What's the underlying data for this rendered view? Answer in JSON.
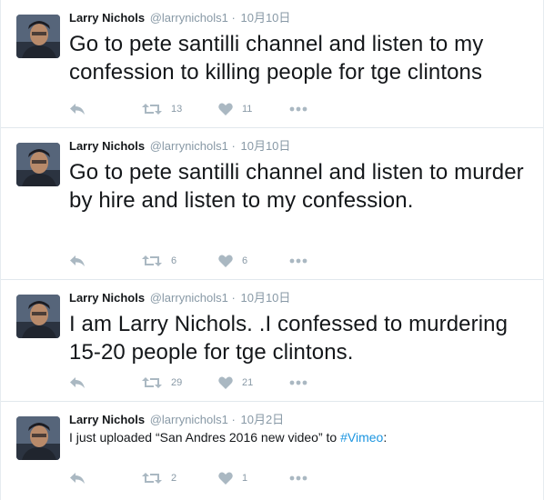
{
  "tweets": [
    {
      "name": "Larry Nichols",
      "handle": "@larrynichols1",
      "dot": "·",
      "time": "10月10日",
      "text": "Go to pete santilli channel and listen to my confession to killing people for tge clintons",
      "retweets": "13",
      "likes": "11"
    },
    {
      "name": "Larry Nichols",
      "handle": "@larrynichols1",
      "dot": "·",
      "time": "10月10日",
      "text": "Go to pete santilli channel and listen to murder by hire and listen to my confession.",
      "retweets": "6",
      "likes": "6"
    },
    {
      "name": "Larry Nichols",
      "handle": "@larrynichols1",
      "dot": "·",
      "time": "10月10日",
      "text": "I am Larry Nichols. .I confessed to murdering 15-20 people for tge clintons.",
      "retweets": "29",
      "likes": "21"
    },
    {
      "name": "Larry Nichols",
      "handle": "@larrynichols1",
      "dot": "·",
      "time": "10月2日",
      "text_before": "I just uploaded “San Andres 2016 new video” to ",
      "text_link": "#Vimeo",
      "text_after": ":",
      "retweets": "2",
      "likes": "1"
    }
  ],
  "icons": {
    "reply": "reply-icon",
    "retweet": "retweet-icon",
    "like": "heart-icon",
    "more": "more-icon"
  },
  "colors": {
    "icon": "#aab8c2",
    "muted": "#8899a6",
    "link": "#1b95e0",
    "divider": "#e1e8ed"
  }
}
